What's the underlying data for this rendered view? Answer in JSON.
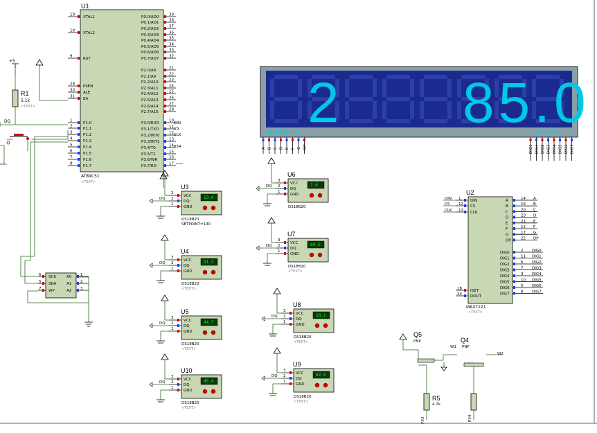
{
  "colors": {
    "chip": "#c8d8b4",
    "wire": "#2a6a1f",
    "display_bg": "#1b2a8f",
    "segment": "#00c8e6",
    "pin_red": "#d00000",
    "pin_blue": "#1c3cff"
  },
  "u1": {
    "ref": "U1",
    "part": "AT89C51",
    "text": "<TEXT>",
    "left_pins": [
      {
        "num": "19",
        "name": "XTAL1"
      },
      {
        "num": "18",
        "name": "XTAL2"
      },
      {
        "num": "9",
        "name": "RST"
      },
      {
        "num": "29",
        "name": "PSEN"
      },
      {
        "num": "30",
        "name": "ALE"
      },
      {
        "num": "31",
        "name": "EA"
      },
      {
        "num": "1",
        "name": "P1.0"
      },
      {
        "num": "2",
        "name": "P1.1"
      },
      {
        "num": "3",
        "name": "P1.2"
      },
      {
        "num": "4",
        "name": "P1.3"
      },
      {
        "num": "5",
        "name": "P1.4"
      },
      {
        "num": "6",
        "name": "P1.5"
      },
      {
        "num": "7",
        "name": "P1.6"
      },
      {
        "num": "8",
        "name": "P1.7"
      }
    ],
    "right_pins": [
      {
        "num": "39",
        "name": "P0.0/AD0"
      },
      {
        "num": "38",
        "name": "P0.1/AD1"
      },
      {
        "num": "37",
        "name": "P0.2/AD2"
      },
      {
        "num": "36",
        "name": "P0.3/AD3"
      },
      {
        "num": "35",
        "name": "P0.4/AD4"
      },
      {
        "num": "34",
        "name": "P0.5/AD5"
      },
      {
        "num": "33",
        "name": "P0.6/AD6"
      },
      {
        "num": "32",
        "name": "P0.7/AD7"
      },
      {
        "num": "21",
        "name": "P2.0/A8"
      },
      {
        "num": "22",
        "name": "P2.1/A9"
      },
      {
        "num": "23",
        "name": "P2.2/A10"
      },
      {
        "num": "24",
        "name": "P2.3/A11"
      },
      {
        "num": "25",
        "name": "P2.4/A12"
      },
      {
        "num": "26",
        "name": "P2.5/A13"
      },
      {
        "num": "27",
        "name": "P2.6/A14"
      },
      {
        "num": "28",
        "name": "P2.7/A15"
      },
      {
        "num": "10",
        "name": "P3.0/RXD"
      },
      {
        "num": "11",
        "name": "P3.1/TXD"
      },
      {
        "num": "12",
        "name": "P3.2/INT0"
      },
      {
        "num": "13",
        "name": "P3.3/INT1"
      },
      {
        "num": "14",
        "name": "P3.4/T0"
      },
      {
        "num": "15",
        "name": "P3.5/T1"
      },
      {
        "num": "16",
        "name": "P3.6/WR"
      },
      {
        "num": "17",
        "name": "P3.7/RD"
      }
    ],
    "net_labels": [
      "DIN",
      "CS",
      "CLK",
      "P34"
    ]
  },
  "r1": {
    "ref": "R1",
    "value": "5.1k",
    "text": "<TEXT>",
    "supply": "+5"
  },
  "dq_label": "DQ",
  "display": {
    "digit_a": "2",
    "digit_b": "85.0",
    "seg_label": "ABCDEFG  DP",
    "digit_label": "12345678",
    "bottom_pins": [
      "A",
      "B",
      "C",
      "D",
      "E",
      "F",
      "G",
      "DP"
    ],
    "digit_pins": [
      "DIG0",
      "DIG1",
      "DIG2",
      "DIG3",
      "DIG4",
      "DIG5",
      "DIG6",
      "DIG7"
    ]
  },
  "sensors": [
    {
      "ref": "U3",
      "reading": "13.0",
      "part": "DS18B20",
      "note": "SETPOINT=130"
    },
    {
      "ref": "U4",
      "reading": "91.3",
      "part": "DS18B20",
      "note": "<TEXT>"
    },
    {
      "ref": "U5",
      "reading": "44.7",
      "part": "DS18B20",
      "note": "<TEXT>"
    },
    {
      "ref": "U10",
      "reading": "45.4",
      "part": "DS18B20",
      "note": "<TEXT>"
    },
    {
      "ref": "U6",
      "reading": "7.0",
      "part": "DS18B20",
      "note": ""
    },
    {
      "ref": "U7",
      "reading": "60.5",
      "part": "DS18B20",
      "note": "<TEXT>"
    },
    {
      "ref": "U8",
      "reading": "18.1",
      "part": "DS18B20",
      "note": "<TEXT>"
    },
    {
      "ref": "U9",
      "reading": "62.9",
      "part": "DS18B20",
      "note": "<TEXT>"
    }
  ],
  "sensor_pins": {
    "vcc": "VCC",
    "dq": "DQ",
    "gnd": "GND",
    "n3": "3",
    "n2": "2",
    "n1": "1",
    "supply": "+5"
  },
  "eeprom": {
    "pins_left": [
      {
        "num": "6",
        "name": "SCK"
      },
      {
        "num": "5",
        "name": "SDA"
      },
      {
        "num": "7",
        "name": "WP"
      }
    ],
    "pins_right": [
      {
        "num": "1",
        "name": "A0"
      },
      {
        "num": "2",
        "name": "A1"
      },
      {
        "num": "3",
        "name": "A2"
      }
    ]
  },
  "u2": {
    "ref": "U2",
    "part": "MAX7221",
    "text": "<TEXT>",
    "left_pins": [
      {
        "num": "1",
        "name": "DIN"
      },
      {
        "num": "12",
        "name": "CS"
      },
      {
        "num": "13",
        "name": "CLK"
      }
    ],
    "left_nets": [
      "DIN",
      "CS",
      "CLK"
    ],
    "bottom_left_pins": [
      {
        "num": "18",
        "name": "ISET"
      },
      {
        "num": "24",
        "name": "DOUT"
      }
    ],
    "seg_pins": [
      {
        "num": "14",
        "name": "A"
      },
      {
        "num": "16",
        "name": "B"
      },
      {
        "num": "20",
        "name": "C"
      },
      {
        "num": "23",
        "name": "D"
      },
      {
        "num": "21",
        "name": "E"
      },
      {
        "num": "15",
        "name": "F"
      },
      {
        "num": "17",
        "name": "G"
      },
      {
        "num": "22",
        "name": "DP"
      }
    ],
    "dig_pins": [
      {
        "num": "2",
        "name": "DIG0"
      },
      {
        "num": "11",
        "name": "DIG1"
      },
      {
        "num": "6",
        "name": "DIG2"
      },
      {
        "num": "7",
        "name": "DIG3"
      },
      {
        "num": "3",
        "name": "DIG4"
      },
      {
        "num": "10",
        "name": "DIG5"
      },
      {
        "num": "5",
        "name": "DIG6"
      },
      {
        "num": "8",
        "name": "DIG7"
      }
    ]
  },
  "transistors": {
    "q5": {
      "ref": "Q5",
      "type": "PNP",
      "net": "W1"
    },
    "q4": {
      "ref": "Q4",
      "type": "PNP",
      "net": "W2"
    },
    "r5": {
      "ref": "R5",
      "value": "4.7k"
    },
    "p33": "P33",
    "p34": "P34"
  }
}
